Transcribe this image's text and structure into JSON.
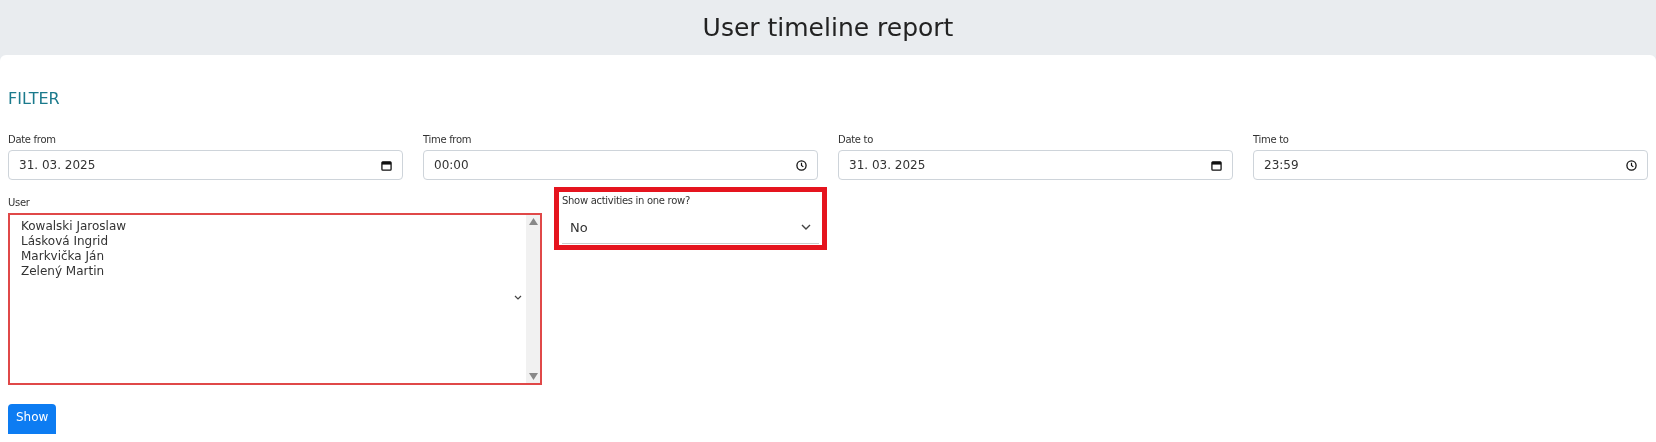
{
  "header": {
    "title": "User timeline report"
  },
  "filter": {
    "heading": "FILTER",
    "fields": [
      {
        "kind": "date",
        "label": "Date from",
        "value": "31. 03. 2025"
      },
      {
        "kind": "time",
        "label": "Time from",
        "value": "00:00"
      },
      {
        "kind": "date",
        "label": "Date to",
        "value": "31. 03. 2025"
      },
      {
        "kind": "time",
        "label": "Time to",
        "value": "23:59"
      }
    ],
    "user": {
      "label": "User",
      "invalid": true,
      "options": [
        "Kowalski Jaroslaw",
        "Lásková Ingrid",
        "Markvička Ján",
        "Zelený Martin"
      ]
    },
    "row_select": {
      "label": "Show activities in one row?",
      "value": "No",
      "highlighted": true
    },
    "button": "Show"
  }
}
